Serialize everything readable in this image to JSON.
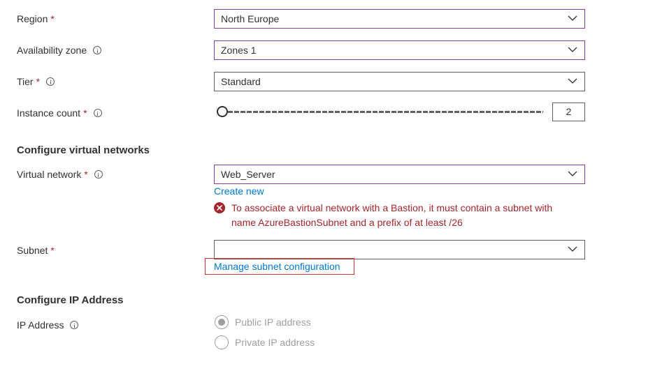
{
  "required_marker": "*",
  "fields": {
    "region": {
      "label": "Region",
      "value": "North Europe"
    },
    "availability_zone": {
      "label": "Availability zone",
      "value": "Zones 1"
    },
    "tier": {
      "label": "Tier",
      "value": "Standard"
    },
    "instance_count": {
      "label": "Instance count",
      "value": "2",
      "slider_fraction": 0
    },
    "virtual_network": {
      "label": "Virtual network",
      "value": "Web_Server",
      "create_new": "Create new"
    },
    "subnet": {
      "label": "Subnet",
      "value": "",
      "manage_link": "Manage subnet configuration"
    },
    "ip_address": {
      "label": "IP Address",
      "options": [
        "Public IP address",
        "Private IP address"
      ],
      "selected": "Public IP address",
      "disabled": true
    }
  },
  "sections": {
    "virtual_networks": "Configure virtual networks",
    "ip_address": "Configure IP Address"
  },
  "error": {
    "line1": "To associate a virtual network with a Bastion, it must contain a subnet with",
    "line2": "name AzureBastionSubnet and a prefix of at least /26"
  },
  "colors": {
    "required": "#a4262c",
    "focus_border": "#8a3ca1",
    "link": "#0078d4",
    "error": "#a4262c",
    "highlight_box": "#d13438",
    "disabled": "#a19f9d"
  },
  "icons": {
    "info": "info-icon",
    "chevron": "chevron-down-icon",
    "error": "error-icon"
  }
}
